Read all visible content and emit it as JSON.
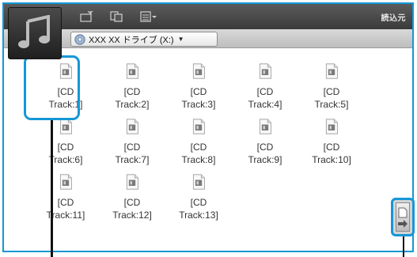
{
  "toolbar": {
    "import_label": "読込元",
    "icons": [
      "music-note-logo-icon",
      "new-folder-icon",
      "copy-icon",
      "view-menu-icon"
    ]
  },
  "drive": {
    "label": "XXX XX ドライブ (X:)",
    "icon": "cd-drive-icon"
  },
  "tracks": [
    {
      "label": "[CD\nTrack:1]"
    },
    {
      "label": "[CD\nTrack:2]"
    },
    {
      "label": "[CD\nTrack:3]"
    },
    {
      "label": "[CD\nTrack:4]"
    },
    {
      "label": "[CD\nTrack:5]"
    },
    {
      "label": "[CD\nTrack:6]"
    },
    {
      "label": "[CD\nTrack:7]"
    },
    {
      "label": "[CD\nTrack:8]"
    },
    {
      "label": "[CD\nTrack:9]"
    },
    {
      "label": "[CD\nTrack:10]"
    },
    {
      "label": "[CD\nTrack:11]"
    },
    {
      "label": "[CD\nTrack:12]"
    },
    {
      "label": "[CD\nTrack:13]"
    }
  ],
  "colors": {
    "highlight": "#1597d6",
    "toolbar_dark": "#3a3a3a"
  }
}
